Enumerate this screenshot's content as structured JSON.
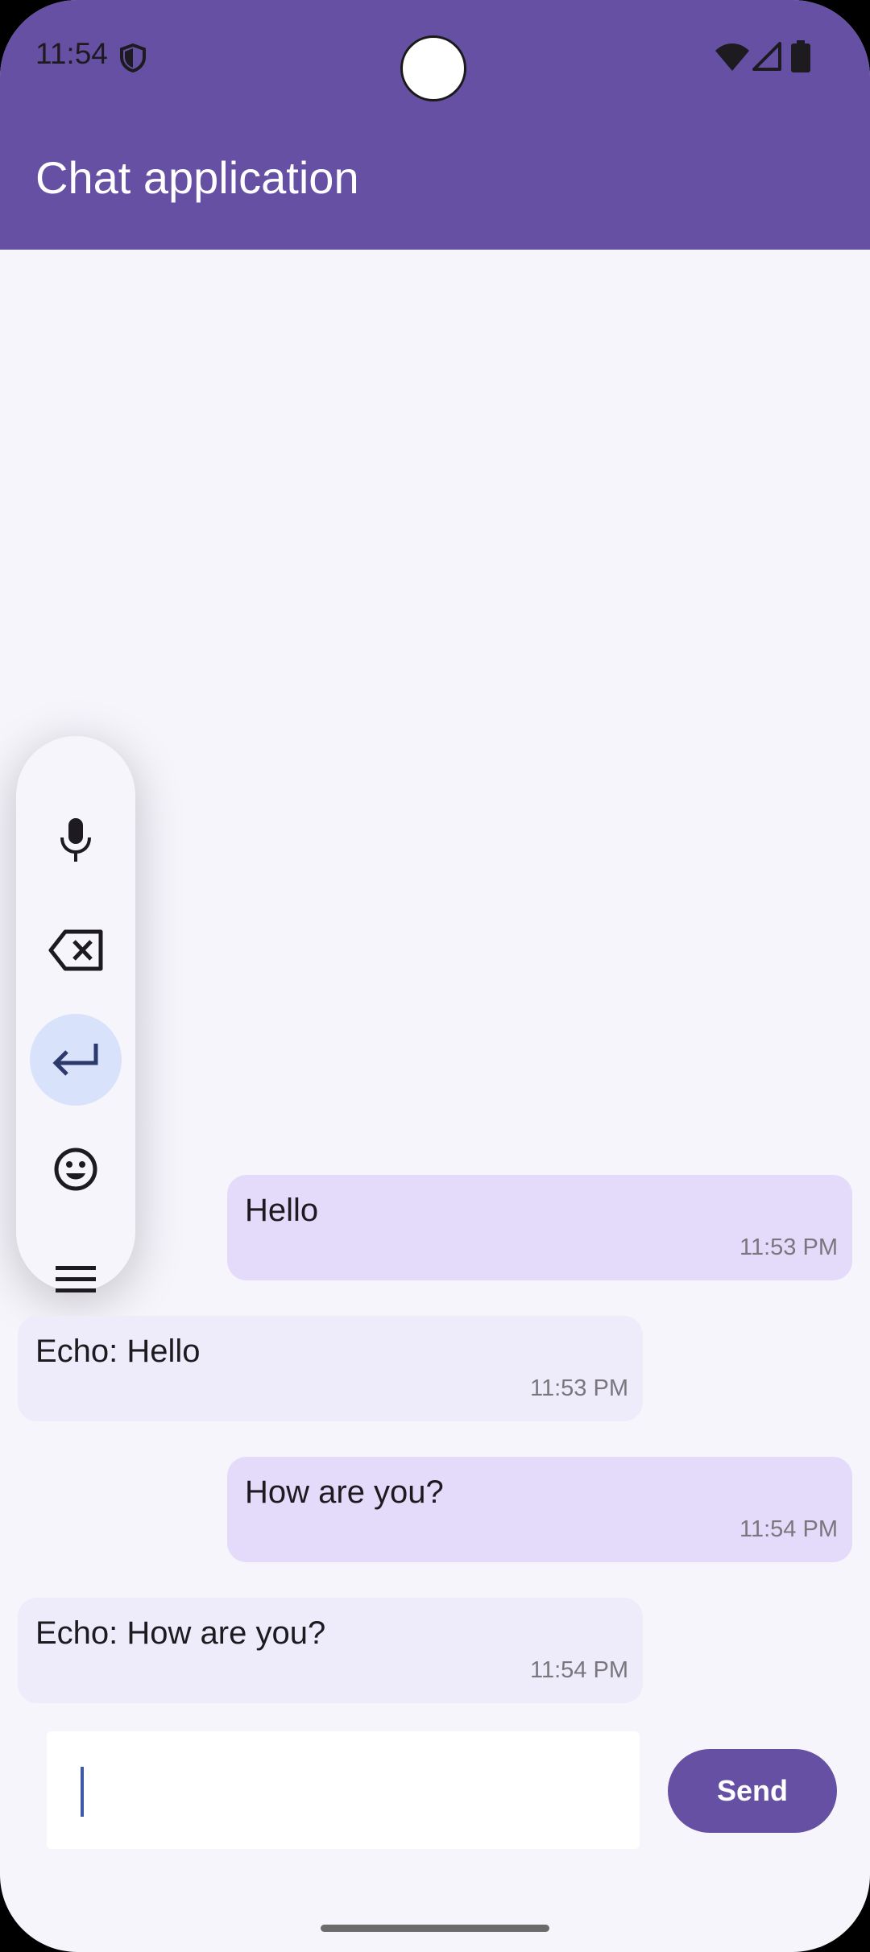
{
  "status_bar": {
    "time": "11:54",
    "icons": [
      "shield-icon",
      "wifi-icon",
      "signal-icon",
      "battery-icon"
    ]
  },
  "app_bar": {
    "title": "Chat application",
    "color": "#6650a4"
  },
  "floating_toolbar": {
    "items": [
      {
        "icon": "microphone-icon",
        "active": false
      },
      {
        "icon": "backspace-icon",
        "active": false
      },
      {
        "icon": "enter-icon",
        "active": true
      },
      {
        "icon": "emoji-icon",
        "active": false
      },
      {
        "icon": "menu-icon",
        "active": false
      }
    ]
  },
  "messages": [
    {
      "sender": "user",
      "text": "Hello",
      "time": "11:53 PM"
    },
    {
      "sender": "bot",
      "text": "Echo: Hello",
      "time": "11:53 PM"
    },
    {
      "sender": "user",
      "text": "How are you?",
      "time": "11:54 PM"
    },
    {
      "sender": "bot",
      "text": "Echo: How are you?",
      "time": "11:54 PM"
    }
  ],
  "composer": {
    "value": "",
    "send_label": "Send"
  },
  "colors": {
    "primary": "#6650a4",
    "sent_bubble": "#e4dbfb",
    "received_bubble": "#eeebfb",
    "background": "#f7f5fc"
  }
}
